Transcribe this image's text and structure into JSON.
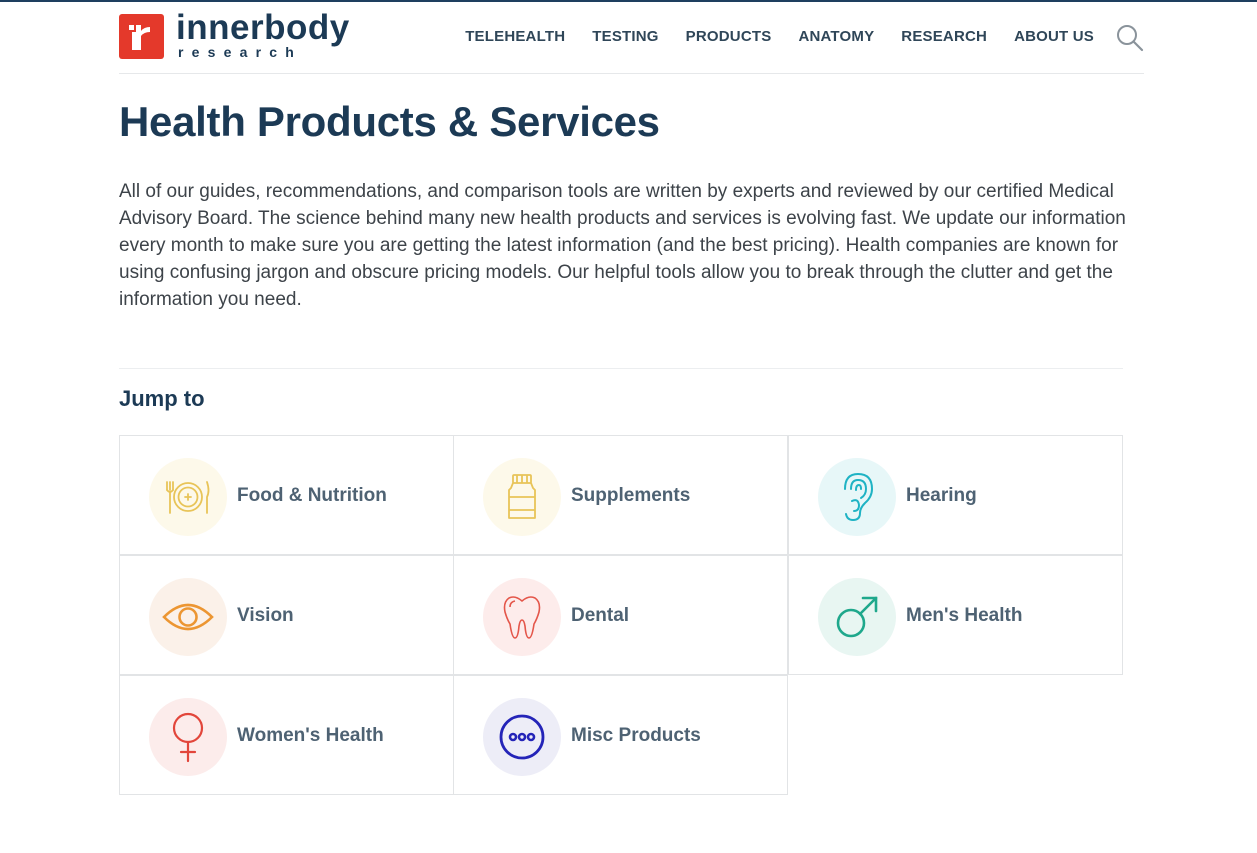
{
  "brand": {
    "name": "innerbody",
    "sub": "research",
    "mark_color": "#e4392b",
    "text_color": "#1c3a55"
  },
  "nav": {
    "items": [
      {
        "label": "TELEHEALTH"
      },
      {
        "label": "TESTING"
      },
      {
        "label": "PRODUCTS"
      },
      {
        "label": "ANATOMY"
      },
      {
        "label": "RESEARCH"
      },
      {
        "label": "ABOUT US"
      }
    ],
    "search_icon": "search-icon"
  },
  "page": {
    "title": "Health Products & Services",
    "intro": "All of our guides, recommendations, and comparison tools are written by experts and reviewed by our certified Medical Advisory Board. The science behind many new health products and services is evolving fast. We update our information every month to make sure you are getting the latest information (and the best pricing). Health companies are known for using confusing jargon and obscure pricing models. Our helpful tools allow you to break through the clutter and get the information you need."
  },
  "jump_to": {
    "title": "Jump to",
    "categories": [
      {
        "label": "Food & Nutrition",
        "icon": "plate-utensils-icon",
        "color": "#e8c458",
        "bg": "#fdf9ea"
      },
      {
        "label": "Supplements",
        "icon": "supplement-bottle-icon",
        "color": "#e8c458",
        "bg": "#fdf9ea"
      },
      {
        "label": "Hearing",
        "icon": "ear-icon",
        "color": "#1fb3c4",
        "bg": "#e7f7f8"
      },
      {
        "label": "Vision",
        "icon": "eye-icon",
        "color": "#ec9632",
        "bg": "#fbf1e9"
      },
      {
        "label": "Dental",
        "icon": "tooth-icon",
        "color": "#e4564a",
        "bg": "#fdeceb"
      },
      {
        "label": "Men's Health",
        "icon": "male-symbol-icon",
        "color": "#1fa88c",
        "bg": "#e8f6f2"
      },
      {
        "label": "Women's Health",
        "icon": "female-symbol-icon",
        "color": "#e2463b",
        "bg": "#fceceb"
      },
      {
        "label": "Misc Products",
        "icon": "more-dots-icon",
        "color": "#2424b8",
        "bg": "#ededf7"
      }
    ]
  }
}
